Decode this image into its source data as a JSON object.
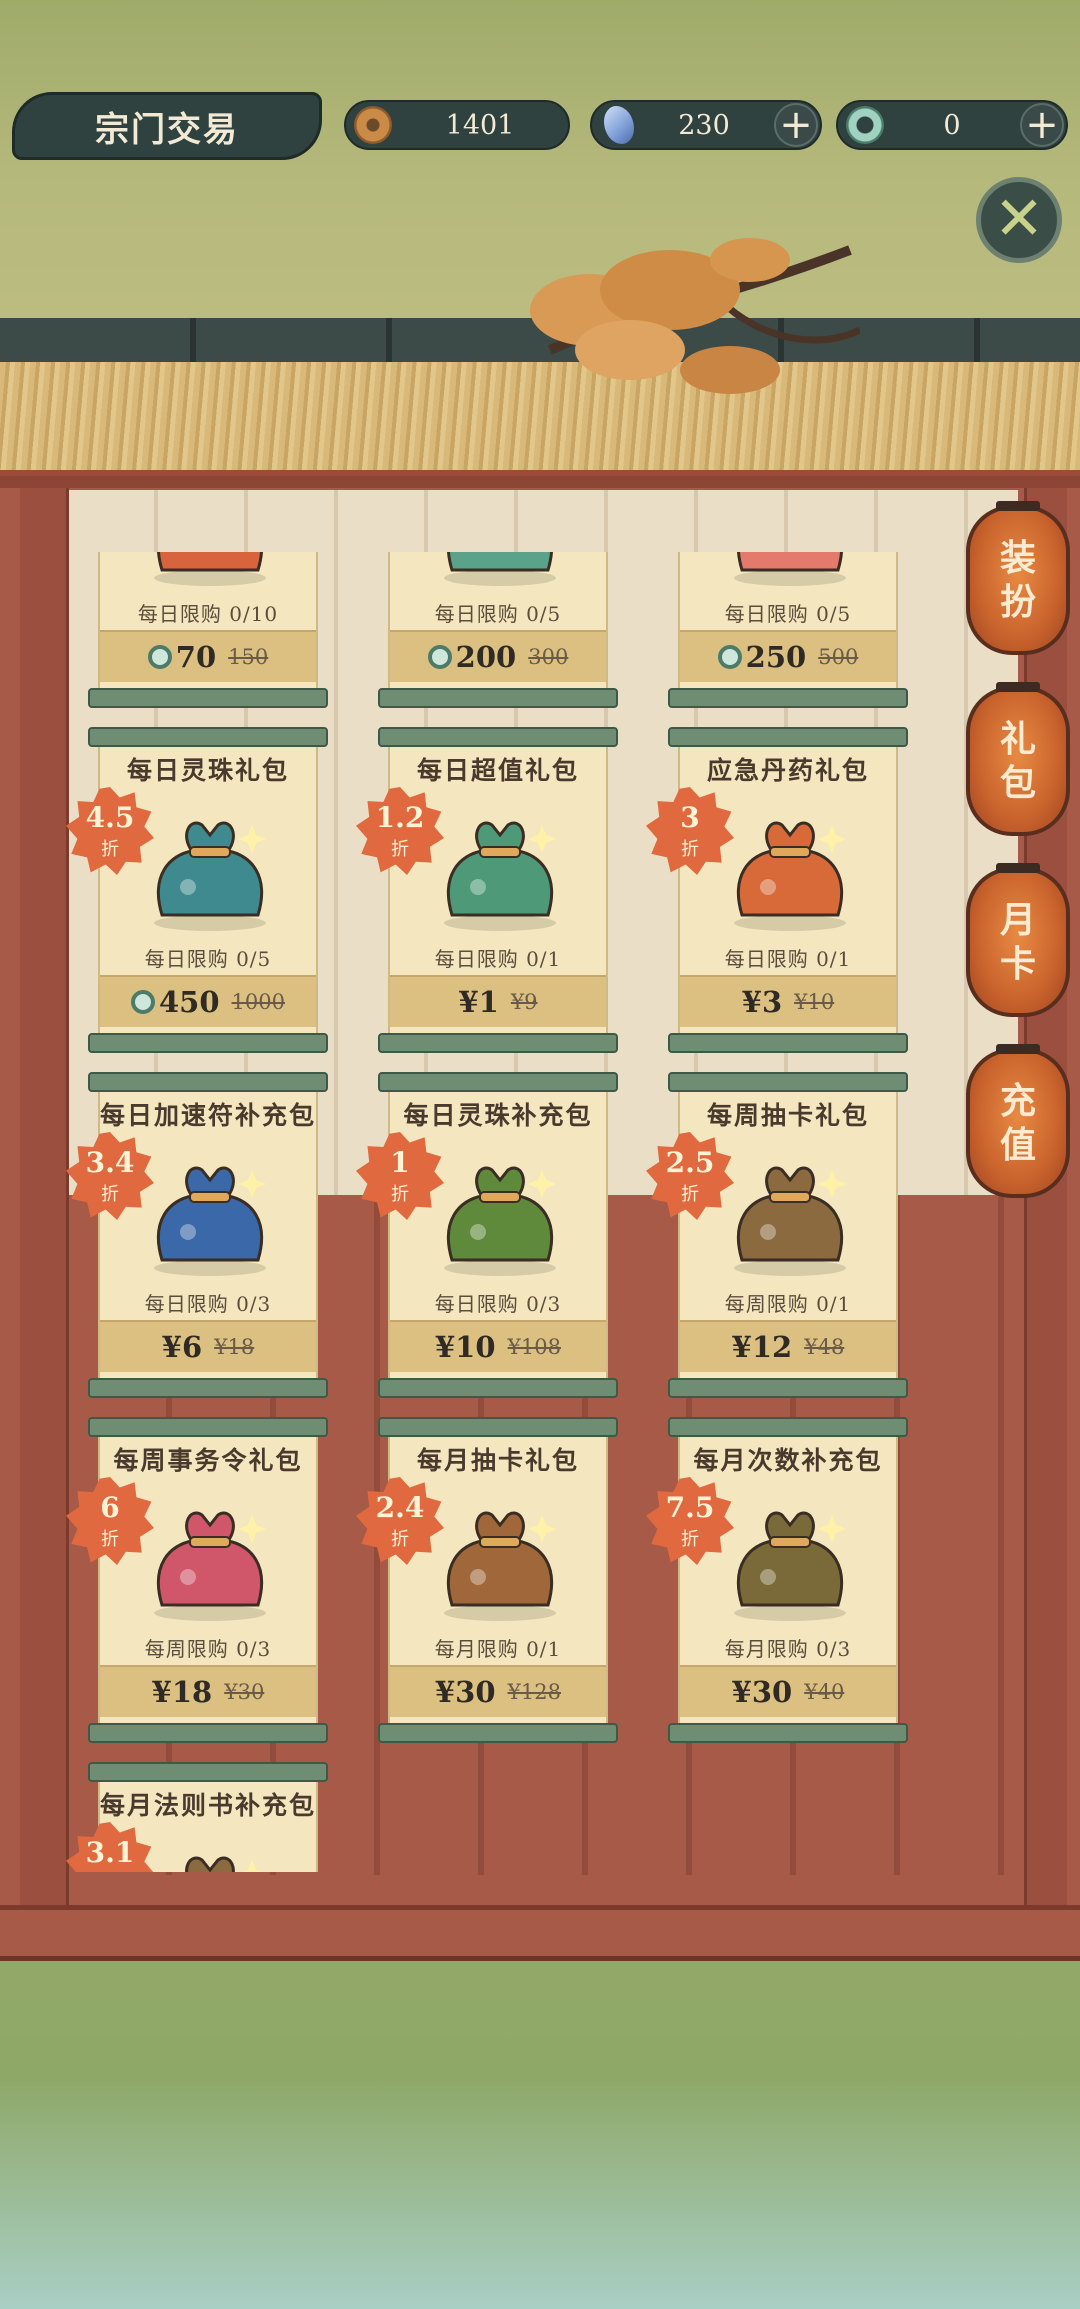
{
  "header": {
    "title": "宗门交易",
    "coins": "1401",
    "gems": "230",
    "jade": "0"
  },
  "side_tabs": [
    {
      "chars": [
        "装",
        "扮"
      ]
    },
    {
      "chars": [
        "礼",
        "包"
      ]
    },
    {
      "chars": [
        "月",
        "卡"
      ]
    },
    {
      "chars": [
        "充",
        "值"
      ]
    }
  ],
  "items": [
    {
      "name": "",
      "discount": "",
      "limit": "每日限购 0/10",
      "price": "70",
      "price_type": "jade",
      "old_price": "150",
      "color": "#d8643e"
    },
    {
      "name": "",
      "discount": "",
      "limit": "每日限购 0/5",
      "price": "200",
      "price_type": "jade",
      "old_price": "300",
      "color": "#5aa38a"
    },
    {
      "name": "",
      "discount": "",
      "limit": "每日限购 0/5",
      "price": "250",
      "price_type": "jade",
      "old_price": "500",
      "color": "#e47a6c"
    },
    {
      "name": "每日灵珠礼包",
      "discount": "4.5",
      "limit": "每日限购 0/5",
      "price": "450",
      "price_type": "jade",
      "old_price": "1000",
      "color": "#3f8a8e"
    },
    {
      "name": "每日超值礼包",
      "discount": "1.2",
      "limit": "每日限购 0/1",
      "price": "¥1",
      "price_type": "cash",
      "old_price": "¥9",
      "color": "#4e9a78"
    },
    {
      "name": "应急丹药礼包",
      "discount": "3",
      "limit": "每日限购 0/1",
      "price": "¥3",
      "price_type": "cash",
      "old_price": "¥10",
      "color": "#d86a3a"
    },
    {
      "name": "每日加速符补充包",
      "discount": "3.4",
      "limit": "每日限购 0/3",
      "price": "¥6",
      "price_type": "cash",
      "old_price": "¥18",
      "color": "#3a68a8"
    },
    {
      "name": "每日灵珠补充包",
      "discount": "1",
      "limit": "每日限购 0/3",
      "price": "¥10",
      "price_type": "cash",
      "old_price": "¥108",
      "color": "#5f8a3c"
    },
    {
      "name": "每周抽卡礼包",
      "discount": "2.5",
      "limit": "每周限购 0/1",
      "price": "¥12",
      "price_type": "cash",
      "old_price": "¥48",
      "color": "#8a6a3e"
    },
    {
      "name": "每周事务令礼包",
      "discount": "6",
      "limit": "每周限购 0/3",
      "price": "¥18",
      "price_type": "cash",
      "old_price": "¥30",
      "color": "#d0566a"
    },
    {
      "name": "每月抽卡礼包",
      "discount": "2.4",
      "limit": "每月限购 0/1",
      "price": "¥30",
      "price_type": "cash",
      "old_price": "¥128",
      "color": "#a0683a"
    },
    {
      "name": "每月次数补充包",
      "discount": "7.5",
      "limit": "每月限购 0/3",
      "price": "¥30",
      "price_type": "cash",
      "old_price": "¥40",
      "color": "#7a6a3a"
    },
    {
      "name": "每月法则书补充包",
      "discount": "3.1",
      "limit": "",
      "price": "",
      "price_type": "cash",
      "old_price": "",
      "color": "#8a6a3e"
    }
  ],
  "zhe_label": "折",
  "colors": {
    "accent": "#e0693f",
    "panel": "#2f4240",
    "paper": "#f4e7bf"
  }
}
